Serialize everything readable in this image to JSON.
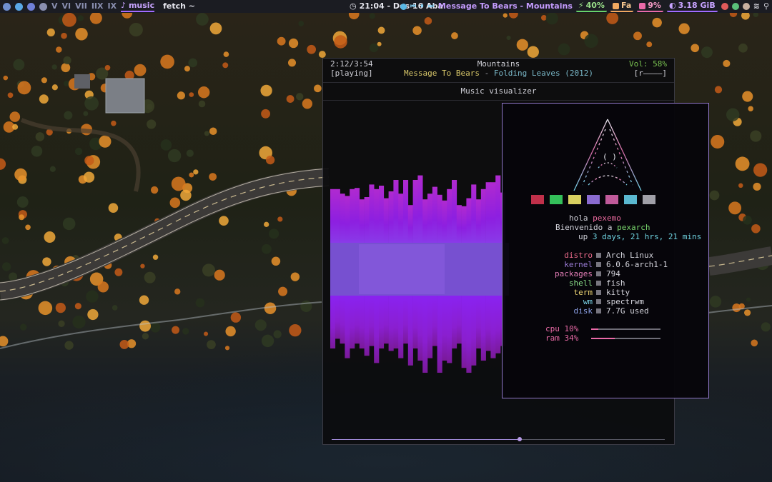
{
  "topbar": {
    "workspaces": [
      "V",
      "VI",
      "VII",
      "IIX",
      "IX"
    ],
    "active_workspace": "music",
    "window_title": "fetch ~",
    "clock": "21:04 - Dos 16 Aba",
    "media_song": "Message To Bears - Mountains",
    "battery": "40%",
    "fan": "Fa",
    "cpu": "9%",
    "memory": "3.18 GiB",
    "colors": {
      "accent": "#a26bff",
      "battery": "#69d36a",
      "fan": "#f0a860",
      "cpu": "#ea6aa8"
    }
  },
  "player": {
    "time": "2:12/3:54",
    "playlist": "Mountains",
    "volume": "Vol: 58%",
    "state": "[playing]",
    "artist": "Message To Bears",
    "separator": "-",
    "album": "Folding Leaves (2012)",
    "flags": "[r————]",
    "visualizer_title": "Music visualizer",
    "progress_fraction": 0.565
  },
  "fetch": {
    "greeting_prefix": "hola ",
    "user": "pexemo",
    "welcome_prefix": "Bienvenido a ",
    "host": "pexarch",
    "uptime_prefix": "up ",
    "uptime": "3 days, 21 hrs, 21 mins",
    "info": [
      {
        "key": "distro",
        "value": "Arch Linux"
      },
      {
        "key": "kernel",
        "value": "6.0.6-arch1-1"
      },
      {
        "key": "packages",
        "value": "794"
      },
      {
        "key": "shell",
        "value": "fish"
      },
      {
        "key": "term",
        "value": "kitty"
      },
      {
        "key": "wm",
        "value": "spectrwm"
      },
      {
        "key": "disk",
        "value": "7.7G used"
      }
    ],
    "meters": [
      {
        "label": "cpu 10%",
        "fraction": 0.1
      },
      {
        "label": "ram 34%",
        "fraction": 0.34
      }
    ],
    "palette": [
      "#c0304a",
      "#34c05a",
      "#d8d060",
      "#8a6bd0",
      "#c05a9a",
      "#5ab8d0",
      "#a0a0a8"
    ]
  }
}
